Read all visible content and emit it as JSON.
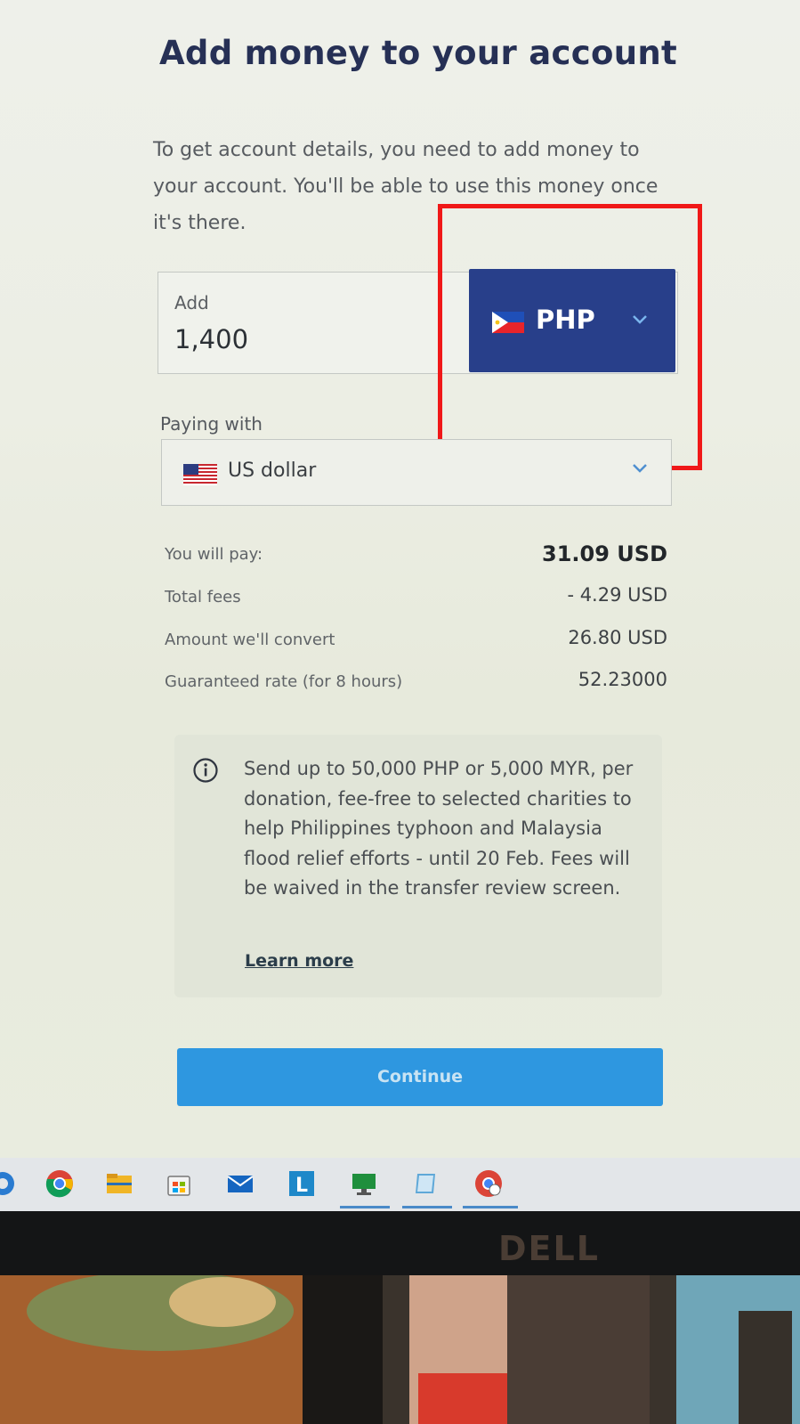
{
  "page": {
    "title": "Add money to your account",
    "intro": "To get account details, you need to add money to your account. You'll be able to use this money once it's there."
  },
  "add": {
    "label": "Add",
    "amount": "1,400",
    "currency_code": "PHP",
    "currency_flag": "philippines-flag-icon"
  },
  "paying": {
    "label": "Paying with",
    "currency_name": "US dollar",
    "currency_flag": "us-flag-icon"
  },
  "summary": [
    {
      "label": "You will pay:",
      "value": "31.09 USD"
    },
    {
      "label": "Total fees",
      "value": "- 4.29 USD"
    },
    {
      "label": "Amount we'll convert",
      "value": "26.80 USD"
    },
    {
      "label": "Guaranteed rate (for 8 hours)",
      "value": "52.23000"
    }
  ],
  "notice": {
    "icon": "info-icon",
    "text": "Send up to 50,000 PHP or 5,000 MYR, per donation, fee-free to selected charities to help Philippines typhoon and Malaysia flood relief efforts - until 20 Feb. Fees will be waived in the transfer review screen.",
    "link": "Learn more"
  },
  "actions": {
    "continue": "Continue"
  },
  "taskbar": {
    "apps": [
      "edge-icon",
      "chrome-icon",
      "file-explorer-icon",
      "store-icon",
      "mail-icon",
      "l-app-icon",
      "remote-desktop-icon",
      "notes-icon",
      "chrome-profile-icon"
    ]
  },
  "monitor": {
    "brand": "DELL"
  },
  "colors": {
    "accent_navy": "#283f8a",
    "continue_blue": "#2e97e0",
    "highlight_red": "#f01818",
    "title": "#263055"
  }
}
